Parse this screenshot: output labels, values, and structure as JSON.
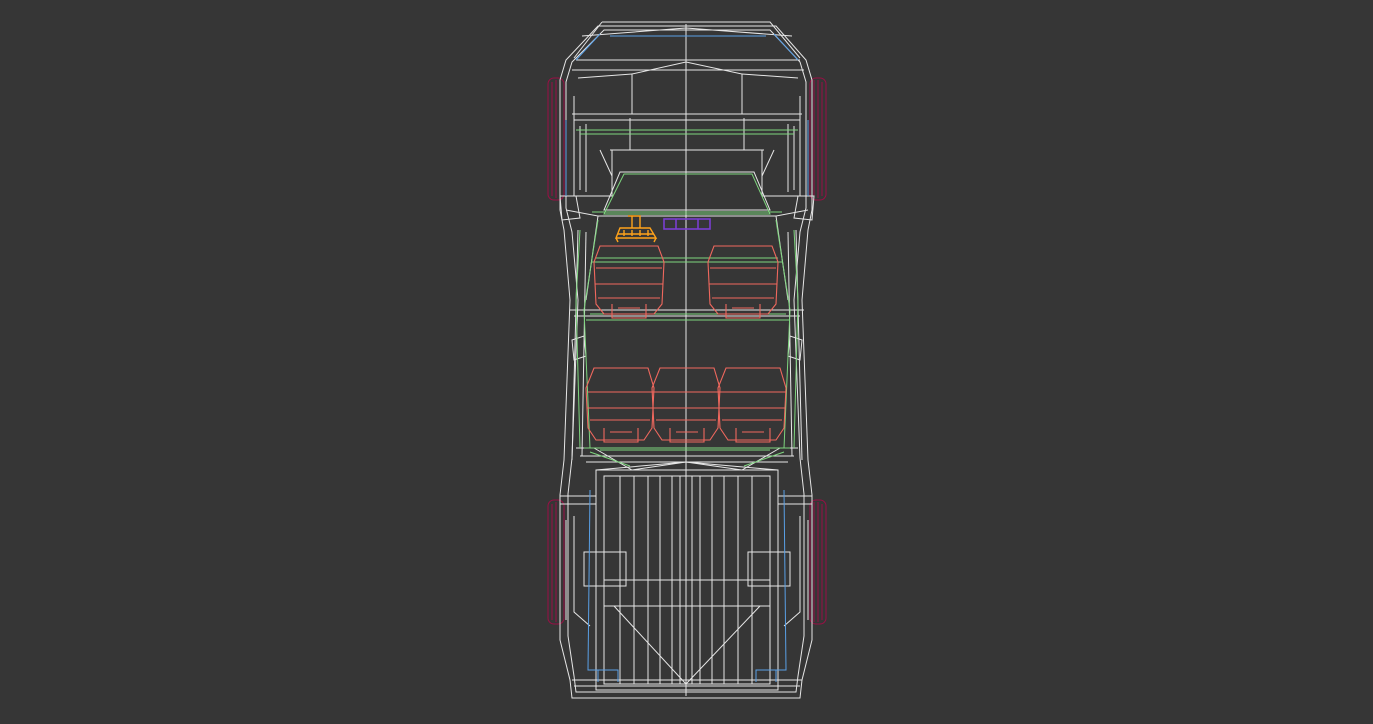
{
  "viewport": {
    "background": "#363636",
    "view": "top",
    "object": "pickup-truck-wireframe"
  },
  "colors": {
    "body": "#e6e6e6",
    "interior": "#7ed57e",
    "seats": "#f0685e",
    "wheels": "#9a0f45",
    "edges": "#5aa0e6",
    "steering": "#ffa21a",
    "dashboard_item": "#7a3fd0"
  },
  "counts": {
    "front_seats": 2,
    "rear_seats": 3,
    "wheels": 4
  }
}
